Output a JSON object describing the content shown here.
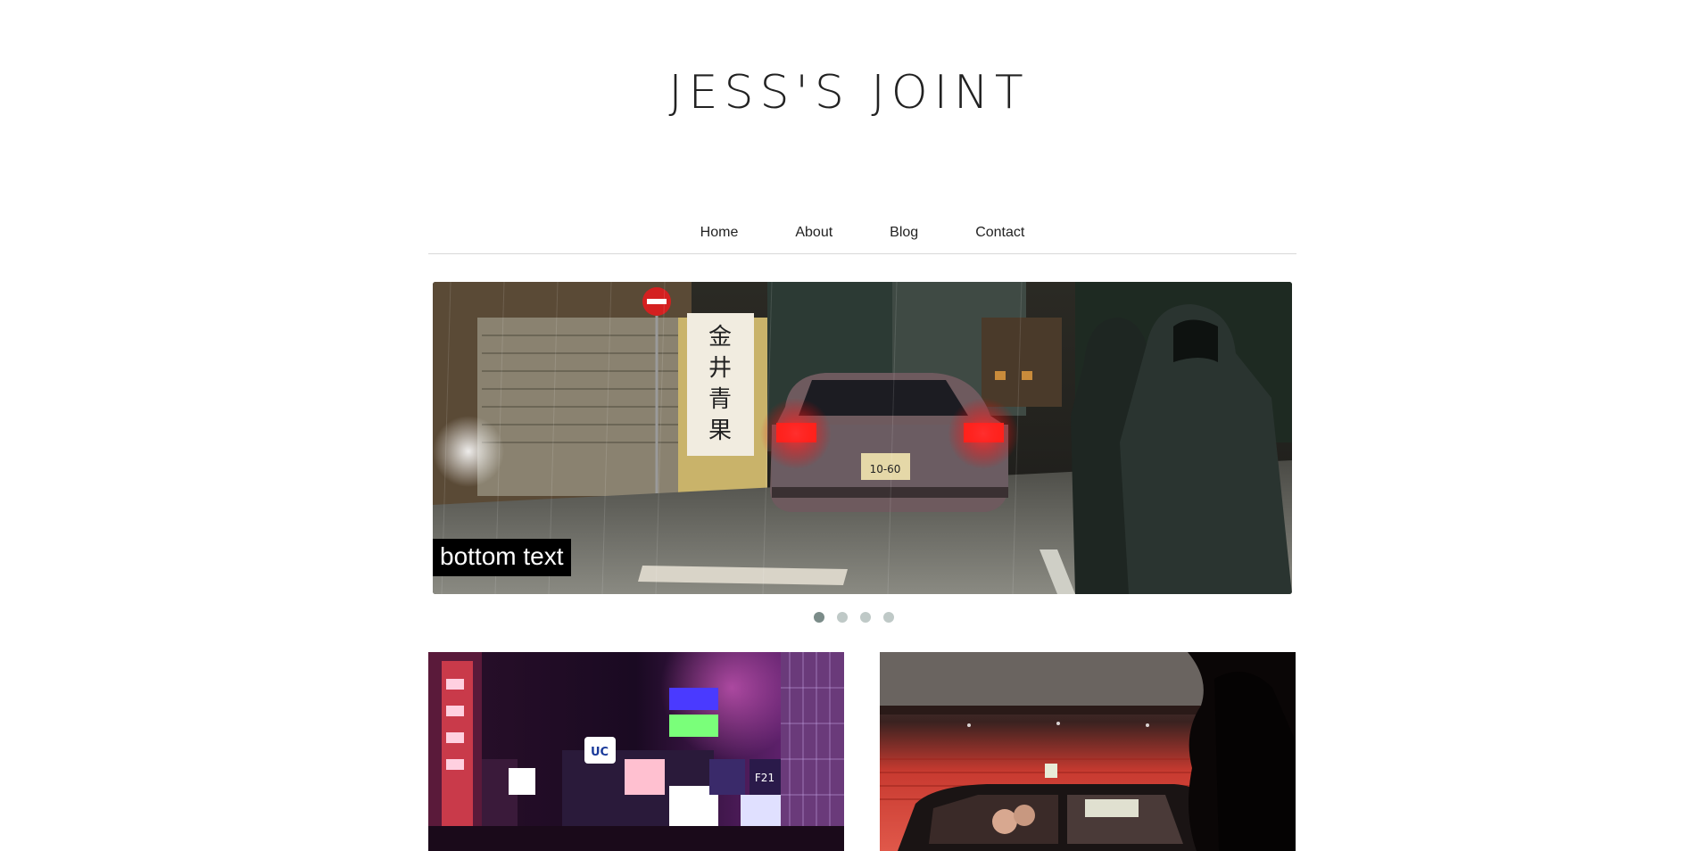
{
  "site": {
    "title": "JESS'S JOINT"
  },
  "nav": {
    "items": [
      {
        "label": "Home"
      },
      {
        "label": "About"
      },
      {
        "label": "Blog"
      },
      {
        "label": "Contact"
      }
    ]
  },
  "slider": {
    "caption": "bottom text",
    "slide_count": 4,
    "active_index": 0
  },
  "thumbnails": [
    {
      "subject": "neon-city-street-photo"
    },
    {
      "subject": "taxi-at-night-photo"
    }
  ]
}
